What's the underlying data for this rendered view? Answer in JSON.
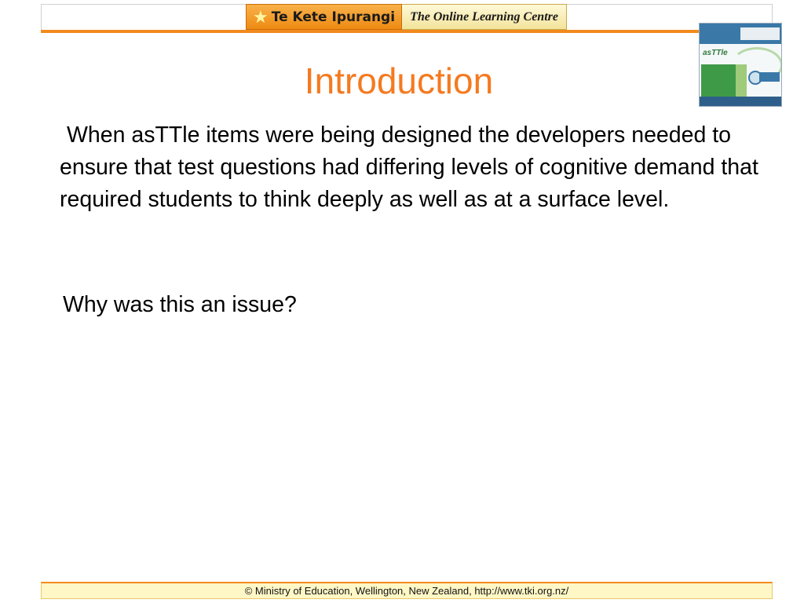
{
  "header": {
    "brand_left": "Te Kete Ipurangi",
    "brand_right": "The Online Learning Centre",
    "thumbnail_logo": "asTTle"
  },
  "slide": {
    "title": "Introduction",
    "paragraph": "When asTTle items were being designed the developers needed to ensure that test questions had differing levels of cognitive demand that required students to think deeply as well as at a surface level.",
    "question": "Why was this an issue?"
  },
  "footer": {
    "text": "© Ministry of Education, Wellington, New Zealand, http://www.tki.org.nz/"
  },
  "colors": {
    "title": "#f47a20",
    "accent_orange": "#f28a1e",
    "footer_bg": "#fff7c6"
  }
}
